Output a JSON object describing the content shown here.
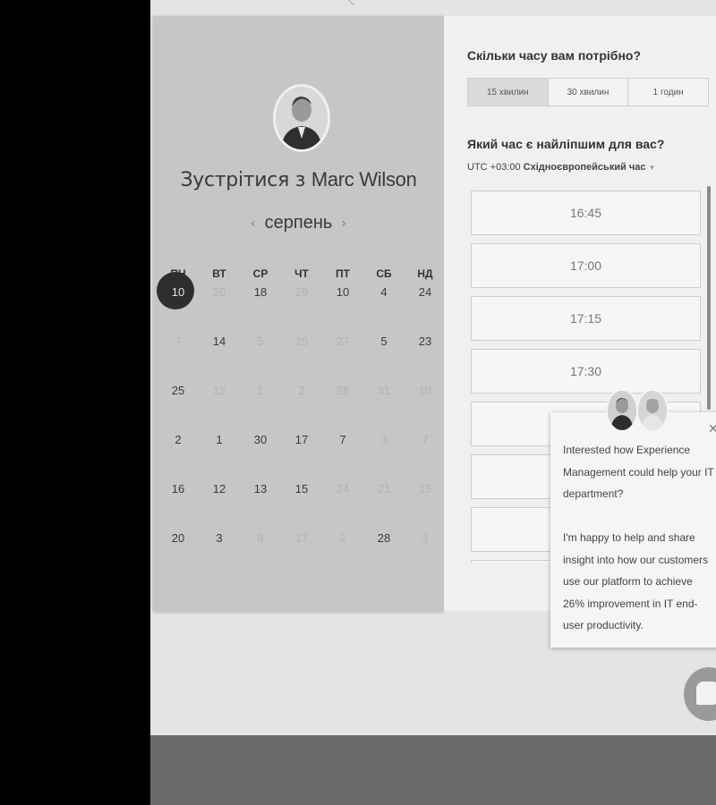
{
  "host": {
    "title_prefix": "Зустрітися з ",
    "name": "Marc Wilson"
  },
  "calendar": {
    "month": "серпень",
    "prev_icon": "chevron-left-icon",
    "next_icon": "chevron-right-icon",
    "weekdays": [
      "ПН",
      "ВТ",
      "СР",
      "ЧТ",
      "ПТ",
      "СБ",
      "НД"
    ],
    "weeks": [
      [
        {
          "d": "10",
          "s": "selected"
        },
        {
          "d": "20",
          "s": "dim"
        },
        {
          "d": "18",
          "s": "active"
        },
        {
          "d": "29",
          "s": "dim"
        },
        {
          "d": "10",
          "s": "active"
        },
        {
          "d": "4",
          "s": "active"
        },
        {
          "d": "24",
          "s": "active"
        }
      ],
      [
        {
          "d": "7",
          "s": "dim"
        },
        {
          "d": "14",
          "s": "active"
        },
        {
          "d": "5",
          "s": "dim"
        },
        {
          "d": "25",
          "s": "dim"
        },
        {
          "d": "27",
          "s": "dim"
        },
        {
          "d": "5",
          "s": "active"
        },
        {
          "d": "23",
          "s": "active"
        }
      ],
      [
        {
          "d": "25",
          "s": "active"
        },
        {
          "d": "13",
          "s": "dim"
        },
        {
          "d": "1",
          "s": "dim"
        },
        {
          "d": "2",
          "s": "dim"
        },
        {
          "d": "28",
          "s": "dim"
        },
        {
          "d": "31",
          "s": "dim"
        },
        {
          "d": "10",
          "s": "dim"
        }
      ],
      [
        {
          "d": "2",
          "s": "active"
        },
        {
          "d": "1",
          "s": "active"
        },
        {
          "d": "30",
          "s": "active"
        },
        {
          "d": "17",
          "s": "active"
        },
        {
          "d": "7",
          "s": "active"
        },
        {
          "d": "3",
          "s": "dim"
        },
        {
          "d": "7",
          "s": "dim"
        }
      ],
      [
        {
          "d": "16",
          "s": "active"
        },
        {
          "d": "12",
          "s": "active"
        },
        {
          "d": "13",
          "s": "active"
        },
        {
          "d": "15",
          "s": "active"
        },
        {
          "d": "24",
          "s": "dim"
        },
        {
          "d": "21",
          "s": "dim"
        },
        {
          "d": "15",
          "s": "dim"
        }
      ],
      [
        {
          "d": "20",
          "s": "active"
        },
        {
          "d": "3",
          "s": "active"
        },
        {
          "d": "8",
          "s": "dim"
        },
        {
          "d": "17",
          "s": "dim"
        },
        {
          "d": "2",
          "s": "dim"
        },
        {
          "d": "28",
          "s": "active"
        },
        {
          "d": "3",
          "s": "dim"
        }
      ]
    ]
  },
  "duration": {
    "question": "Скільки часу вам потрібно?",
    "options": [
      "15 хвилин",
      "30 хвилин",
      "1 годин"
    ],
    "selected_index": 0
  },
  "time": {
    "question": "Який час є найліпшим для вас?",
    "tz_offset": "UTC +03:00 ",
    "tz_name": "Східноєвропейський час",
    "tz_caret_icon": "caret-down-icon",
    "slots": [
      "16:45",
      "17:00",
      "17:15",
      "17:30",
      "",
      "",
      "",
      ""
    ]
  },
  "popup": {
    "message": "Interested how Experience Management could help your IT department?\n\nI'm happy to help and share insight into how our customers use our platform to achieve 26% improvement in IT end-user productivity.",
    "close_icon": "close-icon"
  },
  "chat": {
    "icon": "chat-bubble-icon"
  },
  "colors": {
    "selected_day": "#2e2e2e",
    "left_panel": "#c6c6c6",
    "right_panel": "#f0f0f0"
  }
}
